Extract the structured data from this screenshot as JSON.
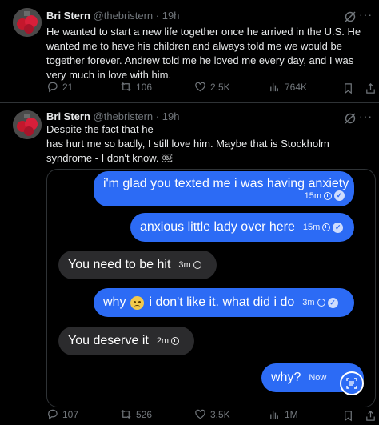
{
  "tweets": [
    {
      "name": "Bri Stern",
      "handle": "@thebristern",
      "sep": "·",
      "time": "19h",
      "text": "He wanted to start a new life together once he arrived in the U.S. He wanted me to have his children and always told me we would be together forever. Andrew told me he loved me every day, and I was very much in love with him.",
      "replies": "21",
      "reposts": "106",
      "likes": "2.5K",
      "views": "764K"
    },
    {
      "name": "Bri Stern",
      "handle": "@thebristern",
      "sep": "·",
      "time": "19h",
      "text_line1": "Despite the fact that he",
      "text_rest": "has hurt me so badly, I still love him. Maybe that is Stockholm syndrome - I don't know. ￼",
      "replies": "107",
      "reposts": "526",
      "likes": "3.5K",
      "views": "1M"
    }
  ],
  "messages": [
    {
      "text": "i'm glad you texted me i was having anxiety",
      "time": "15m",
      "dir": "sent"
    },
    {
      "text": "anxious little lady over here",
      "time": "15m",
      "dir": "sent"
    },
    {
      "text": "You need to be hit",
      "time": "3m",
      "dir": "received"
    },
    {
      "text_before": "why",
      "text_after": "i don't like it. what did i do",
      "time": "3m",
      "dir": "sent"
    },
    {
      "text": "You deserve it",
      "time": "2m",
      "dir": "received"
    },
    {
      "text": "why?",
      "time": "Now",
      "dir": "sent"
    }
  ],
  "colors": {
    "sent": "#2c6bf5",
    "received": "#2b2b2d",
    "muted": "#71767b"
  },
  "icons": [
    "grok-icon",
    "more-icon",
    "reply-icon",
    "repost-icon",
    "like-icon",
    "views-icon",
    "bookmark-icon",
    "share-icon",
    "lens-icon",
    "clock-icon",
    "read-check-icon",
    "pleading-face-emoji"
  ]
}
